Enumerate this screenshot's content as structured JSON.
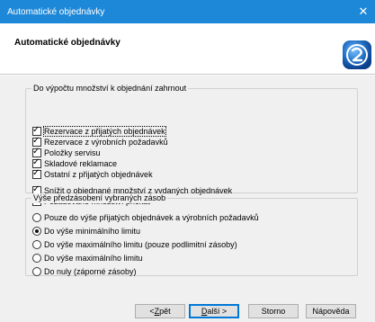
{
  "window": {
    "title": "Automatické objednávky",
    "close_glyph": "✕"
  },
  "header": {
    "heading": "Automatické objednávky",
    "logo_icon": "wizard-logo-icon"
  },
  "group1": {
    "legend": "Do výpočtu množství k objednání zahrnout",
    "items": [
      {
        "label": "Rezervace z přijatých objednávek",
        "checked": true
      },
      {
        "label": "Rezervace z výrobních požadavků",
        "checked": true
      },
      {
        "label": "Položky servisu",
        "checked": true
      },
      {
        "label": "Skladové reklamace",
        "checked": true
      },
      {
        "label": "Ostatní z přijatých objednávek",
        "checked": true
      },
      {
        "label": "Snížit o objednané množství z vydaných objednávek",
        "checked": true
      },
      {
        "label": "Požadované množství přičítat",
        "checked": false
      }
    ]
  },
  "group2": {
    "legend": "Výše předzásobení vybraných zásob",
    "options": [
      {
        "label": "Pouze do výše přijatých objednávek a výrobních požadavků",
        "selected": false
      },
      {
        "label": "Do výše minimálního limitu",
        "selected": true
      },
      {
        "label": "Do výše maximálního limitu (pouze podlimitní zásoby)",
        "selected": false
      },
      {
        "label": "Do výše maximálního limitu",
        "selected": false
      },
      {
        "label": "Do nuly (záporné zásoby)",
        "selected": false
      }
    ]
  },
  "buttons": {
    "back": {
      "prefix": "< ",
      "underline": "Z",
      "rest": "pět"
    },
    "next": {
      "underline": "D",
      "rest": "alší >"
    },
    "cancel": "Storno",
    "help": "Nápověda"
  },
  "colors": {
    "titlebar": "#1e88d8",
    "logo": "#1f6fc5"
  }
}
